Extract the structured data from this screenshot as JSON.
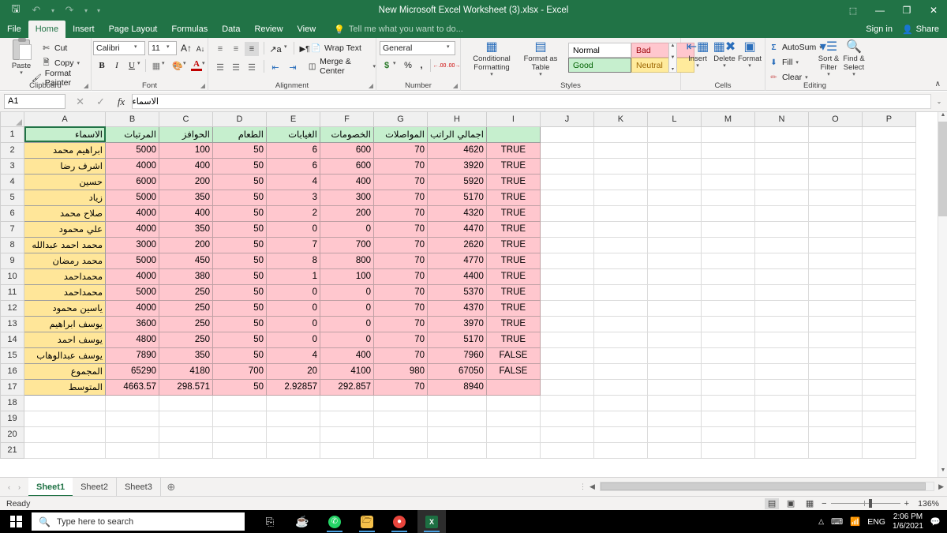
{
  "titlebar": {
    "document_title": "New Microsoft Excel Worksheet (3).xlsx - Excel",
    "qat": [
      {
        "name": "save",
        "glyph": "὚B"
      },
      {
        "name": "undo",
        "glyph": "↶"
      },
      {
        "name": "redo",
        "glyph": "↷"
      },
      {
        "name": "customize",
        "glyph": "▾"
      }
    ],
    "ribbon_display_options": "⬚",
    "minimize": "—",
    "restore": "❐",
    "close": "✕"
  },
  "tabs": [
    {
      "label": "File",
      "active": false
    },
    {
      "label": "Home",
      "active": true
    },
    {
      "label": "Insert",
      "active": false
    },
    {
      "label": "Page Layout",
      "active": false
    },
    {
      "label": "Formulas",
      "active": false
    },
    {
      "label": "Data",
      "active": false
    },
    {
      "label": "Review",
      "active": false
    },
    {
      "label": "View",
      "active": false
    }
  ],
  "tell_me": "Tell me what you want to do...",
  "account": {
    "sign_in": "Sign in",
    "share": "Share"
  },
  "ribbon": {
    "groups": [
      {
        "name": "Clipboard",
        "label": "Clipboard"
      },
      {
        "name": "Font",
        "label": "Font"
      },
      {
        "name": "Alignment",
        "label": "Alignment"
      },
      {
        "name": "Number",
        "label": "Number"
      },
      {
        "name": "Styles",
        "label": "Styles"
      },
      {
        "name": "Cells",
        "label": "Cells"
      },
      {
        "name": "Editing",
        "label": "Editing"
      }
    ],
    "clipboard": {
      "paste": "Paste",
      "cut": "Cut",
      "copy": "Copy",
      "format_painter": "Format Painter"
    },
    "font": {
      "font_name": "Calibri",
      "font_size": "11",
      "bold": "B",
      "italic": "I",
      "underline": "U"
    },
    "alignment": {
      "wrap_text": "Wrap Text",
      "merge_center": "Merge & Center"
    },
    "number": {
      "format": "General",
      "currency": "$",
      "percent": "%",
      "comma": ","
    },
    "styles": {
      "conditional_formatting": "Conditional Formatting",
      "format_as_table": "Format as Table",
      "normal": "Normal",
      "bad": "Bad",
      "good": "Good",
      "neutral": "Neutral"
    },
    "cells": {
      "insert": "Insert",
      "delete": "Delete",
      "format": "Format"
    },
    "editing": {
      "autosum": "AutoSum",
      "fill": "Fill",
      "clear": "Clear",
      "sort_filter": "Sort & Filter",
      "find_select": "Find & Select"
    },
    "collapse_ribbon": "∧"
  },
  "formula_bar": {
    "name_box": "A1",
    "cancel": "✕",
    "enter": "✓",
    "insert_function": "fx",
    "content": "الاسماء",
    "expand": "⌄"
  },
  "grid": {
    "column_headers": [
      "A",
      "B",
      "C",
      "D",
      "E",
      "F",
      "G",
      "H",
      "I",
      "J",
      "K",
      "L",
      "M",
      "N",
      "O",
      "P"
    ],
    "row_numbers": [
      1,
      2,
      3,
      4,
      5,
      6,
      7,
      8,
      9,
      10,
      11,
      12,
      13,
      14,
      15,
      16,
      17,
      18,
      19,
      20,
      21
    ],
    "table_headers": [
      "الاسماء",
      "المرتبات",
      "الحوافز",
      "الطعام",
      "الغيابات",
      "الخصومات",
      "المواصلات",
      "اجمالي الراتب",
      ""
    ],
    "rows": [
      {
        "name": "ابراهيم محمد",
        "values": [
          "5000",
          "100",
          "50",
          "6",
          "600",
          "70",
          "4620"
        ],
        "flag": "TRUE"
      },
      {
        "name": "اشرف رضا",
        "values": [
          "4000",
          "400",
          "50",
          "6",
          "600",
          "70",
          "3920"
        ],
        "flag": "TRUE"
      },
      {
        "name": "حسين",
        "values": [
          "6000",
          "200",
          "50",
          "4",
          "400",
          "70",
          "5920"
        ],
        "flag": "TRUE"
      },
      {
        "name": "زياد",
        "values": [
          "5000",
          "350",
          "50",
          "3",
          "300",
          "70",
          "5170"
        ],
        "flag": "TRUE"
      },
      {
        "name": "صلاح محمد",
        "values": [
          "4000",
          "400",
          "50",
          "2",
          "200",
          "70",
          "4320"
        ],
        "flag": "TRUE"
      },
      {
        "name": "علي محمود",
        "values": [
          "4000",
          "350",
          "50",
          "0",
          "0",
          "70",
          "4470"
        ],
        "flag": "TRUE"
      },
      {
        "name": "محمد احمد عبدالله",
        "values": [
          "3000",
          "200",
          "50",
          "7",
          "700",
          "70",
          "2620"
        ],
        "flag": "TRUE"
      },
      {
        "name": "محمد رمضان",
        "values": [
          "5000",
          "450",
          "50",
          "8",
          "800",
          "70",
          "4770"
        ],
        "flag": "TRUE"
      },
      {
        "name": "محمداحمد",
        "values": [
          "4000",
          "380",
          "50",
          "1",
          "100",
          "70",
          "4400"
        ],
        "flag": "TRUE"
      },
      {
        "name": "محمداحمد",
        "values": [
          "5000",
          "250",
          "50",
          "0",
          "0",
          "70",
          "5370"
        ],
        "flag": "TRUE"
      },
      {
        "name": "ياسين محمود",
        "values": [
          "4000",
          "250",
          "50",
          "0",
          "0",
          "70",
          "4370"
        ],
        "flag": "TRUE"
      },
      {
        "name": "يوسف ابراهيم",
        "values": [
          "3600",
          "250",
          "50",
          "0",
          "0",
          "70",
          "3970"
        ],
        "flag": "TRUE"
      },
      {
        "name": "يوسف احمد",
        "values": [
          "4800",
          "250",
          "50",
          "0",
          "0",
          "70",
          "5170"
        ],
        "flag": "TRUE"
      },
      {
        "name": "يوسف عبدالوهاب",
        "values": [
          "7890",
          "350",
          "50",
          "4",
          "400",
          "70",
          "7960"
        ],
        "flag": "FALSE"
      },
      {
        "name": "المجموع",
        "values": [
          "65290",
          "4180",
          "700",
          "20",
          "4100",
          "980",
          "67050"
        ],
        "flag": "FALSE"
      },
      {
        "name": "المتوسط",
        "values": [
          "4663.57",
          "298.571",
          "50",
          "2.92857",
          "292.857",
          "70",
          "8940"
        ],
        "flag": ""
      }
    ],
    "colors": {
      "header_fill": "#C6EFCE",
      "name_fill": "#FFE699",
      "data_fill": "#FFC7CE"
    }
  },
  "sheet_tabs": {
    "sheets": [
      "Sheet1",
      "Sheet2",
      "Sheet3"
    ],
    "active": "Sheet1",
    "add_sheet": "+",
    "prev": "‹",
    "next": "›"
  },
  "status_bar": {
    "status": "Ready",
    "views": [
      "normal-view",
      "page-layout-view",
      "page-break-view"
    ],
    "zoom_out": "−",
    "zoom_in": "+",
    "zoom_level": "136%"
  },
  "taskbar": {
    "search_placeholder": "Type here to search",
    "apps": [
      "task-view",
      "coffee-app",
      "whatsapp",
      "file-explorer",
      "chrome",
      "excel"
    ],
    "language": "ENG",
    "time": "2:06 PM",
    "date": "1/6/2021",
    "notification_count": "1"
  }
}
